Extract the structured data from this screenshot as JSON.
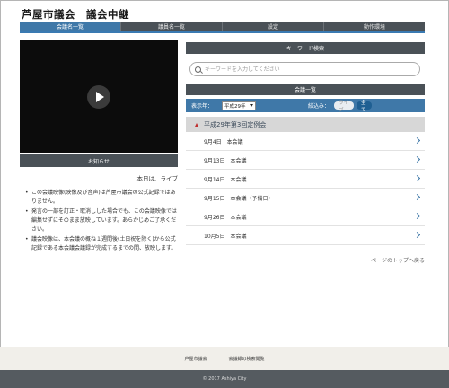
{
  "site": {
    "title": "芦屋市議会　議会中継"
  },
  "nav": {
    "items": [
      {
        "label": "会議名一覧",
        "active": true
      },
      {
        "label": "議員名一覧",
        "active": false
      },
      {
        "label": "設定",
        "active": false
      },
      {
        "label": "動作環境",
        "active": false
      }
    ]
  },
  "video": {
    "play_icon": "play-icon"
  },
  "notice": {
    "label": "お知らせ"
  },
  "today": "本日は、ライブ",
  "notes": [
    "この会議映像(映像及び音声)は芦屋市議会の公式記録ではありません。",
    "発言の一部を訂正・取消しした場合でも、この会議映像では編集せずにそのまま放映しています。あらかじめご了承ください。",
    "議会映像は、本会議の概ね１週間後(土日祝を除く)から公式記録である本会議会議録が完成するまでの間、放映します。"
  ],
  "keyword": {
    "header": "キーワード検索",
    "placeholder": "キーワードを入力してください"
  },
  "list": {
    "header": "会議一覧",
    "year_label": "表示年：",
    "year_value": "平成29年",
    "narrow_label": "絞込み：",
    "filter_live": "ライブ",
    "filter_all": "全て",
    "session": "平成29年第3回定例会",
    "meetings": [
      "9月4日　本会議",
      "9月13日　本会議",
      "9月14日　本会議",
      "9月15日　本会議（予備日）",
      "9月26日　本会議",
      "10月5日　本会議"
    ]
  },
  "page_top": "ページのトップへ戻る",
  "footer": {
    "links": [
      "芦屋市議会",
      "会議録の検索閲覧"
    ],
    "copyright": "© 2017 Ashiya City"
  },
  "colors": {
    "nav_bg": "#4a5157",
    "accent": "#3f78a8",
    "session_bg": "#d7d7d7"
  }
}
